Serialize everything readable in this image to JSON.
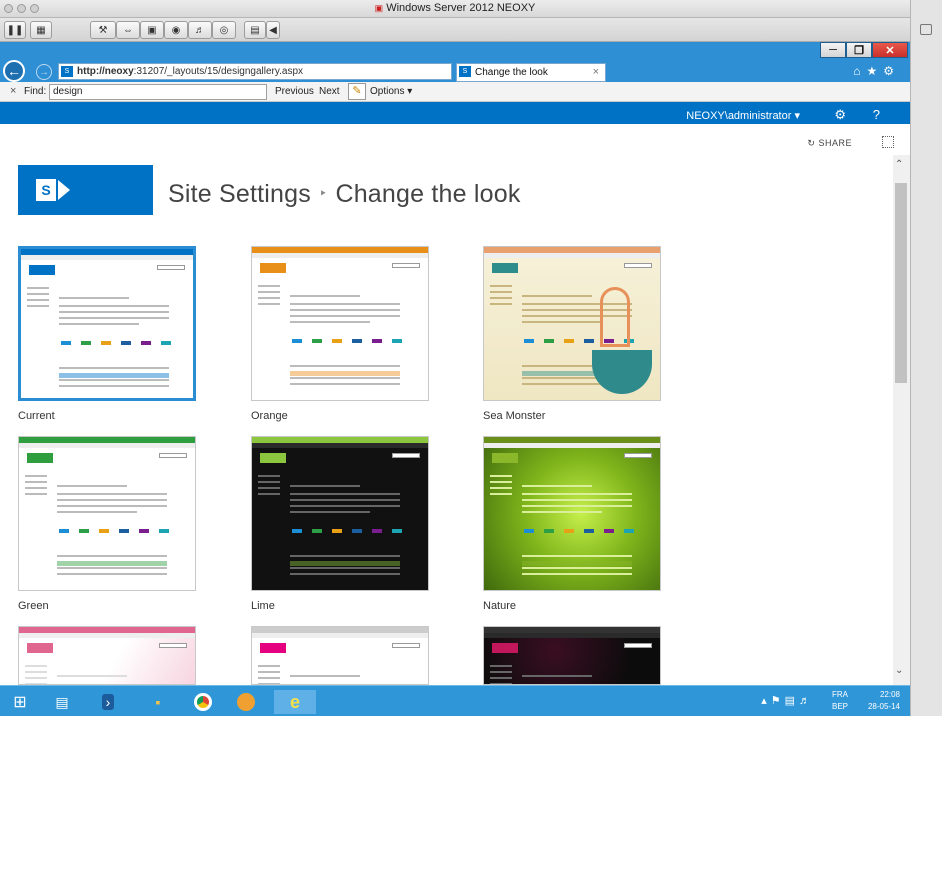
{
  "vm": {
    "title": "Windows Server 2012 NEOXY"
  },
  "browser": {
    "url_host": "http://neoxy",
    "url_path": ":31207/_layouts/15/designgallery.aspx",
    "tab_title": "Change the look",
    "find_label": "Find:",
    "find_value": "design",
    "previous_label": "Previous",
    "next_label": "Next",
    "options_label": "Options"
  },
  "sharepoint": {
    "user": "NEOXY\\administrator",
    "share_label": "SHARE",
    "breadcrumb_parent": "Site Settings",
    "breadcrumb_current": "Change the look"
  },
  "gallery": [
    {
      "label": "Current",
      "selected": true,
      "accent": "#0072c6",
      "style": "light",
      "bar": "#0072c6"
    },
    {
      "label": "Orange",
      "selected": false,
      "accent": "#e88f1a",
      "style": "light",
      "bar": "#e88f1a"
    },
    {
      "label": "Sea Monster",
      "selected": false,
      "accent": "#2d8c8c",
      "style": "sea",
      "bar": "#e8a16e"
    },
    {
      "label": "Green",
      "selected": false,
      "accent": "#2f9e3f",
      "style": "light",
      "bar": "#2f9e3f"
    },
    {
      "label": "Lime",
      "selected": false,
      "accent": "#8cc63f",
      "style": "dark",
      "bar": "#8cc63f"
    },
    {
      "label": "Nature",
      "selected": false,
      "accent": "#8ab82a",
      "style": "nature",
      "bar": "#6a8f1a"
    },
    {
      "label": "",
      "selected": false,
      "accent": "#e06690",
      "style": "pink",
      "bar": "#e06690"
    },
    {
      "label": "",
      "selected": false,
      "accent": "#e4007f",
      "style": "light",
      "bar": "#cccccc"
    },
    {
      "label": "",
      "selected": false,
      "accent": "#c2185b",
      "style": "dark",
      "bar": "#333333"
    }
  ],
  "taskbar": {
    "lang_top": "FRA",
    "lang_bottom": "BEP",
    "time": "22:08",
    "date": "28-05-14"
  }
}
